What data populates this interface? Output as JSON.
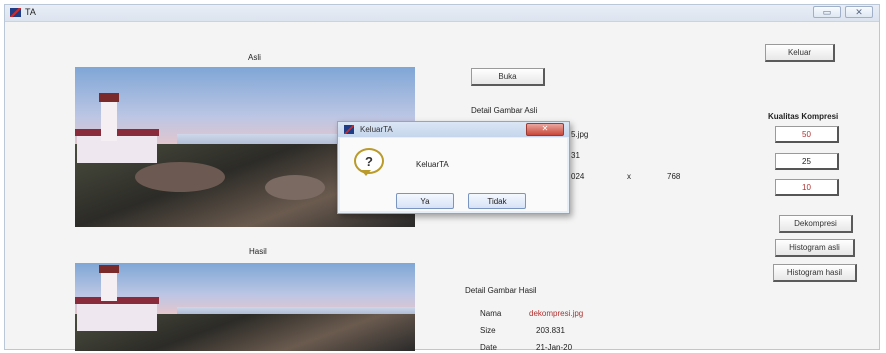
{
  "window": {
    "title": "TA",
    "controls": [
      "▭",
      "✕"
    ]
  },
  "left": {
    "asli_label": "Asli",
    "hasil_label": "Hasil"
  },
  "middle": {
    "buka_label": "Buka",
    "detail_asli_title": "Detail Gambar Asli",
    "detail_asli_visible": [
      {
        "value": "5.jpg"
      },
      {
        "value": "31"
      },
      {
        "value": "024"
      }
    ],
    "dim_x_symbol": "x",
    "dim_height": "768",
    "detail_hasil_title": "Detail Gambar Hasil",
    "detail_hasil": [
      {
        "label": "Nama",
        "value": "dekompresi.jpg",
        "value_color": "#b03030"
      },
      {
        "label": "Size",
        "value": "203.831",
        "value_color": "#111111"
      },
      {
        "label": "Date",
        "value": "21-Jan-20",
        "value_color": "#111111"
      }
    ]
  },
  "right": {
    "keluar_label": "Keluar",
    "kualitas_title": "Kualitas Kompresi",
    "kualitas_values": [
      "50",
      "25",
      "10"
    ],
    "dekompresi_label": "Dekompresi",
    "histogram_asli_label": "Histogram asli",
    "histogram_hasil_label": "Histogram hasil"
  },
  "dialog": {
    "title": "KeluarTA",
    "message": "KeluarTA",
    "close_label": "✕",
    "yes_label": "Ya",
    "no_label": "Tidak"
  }
}
